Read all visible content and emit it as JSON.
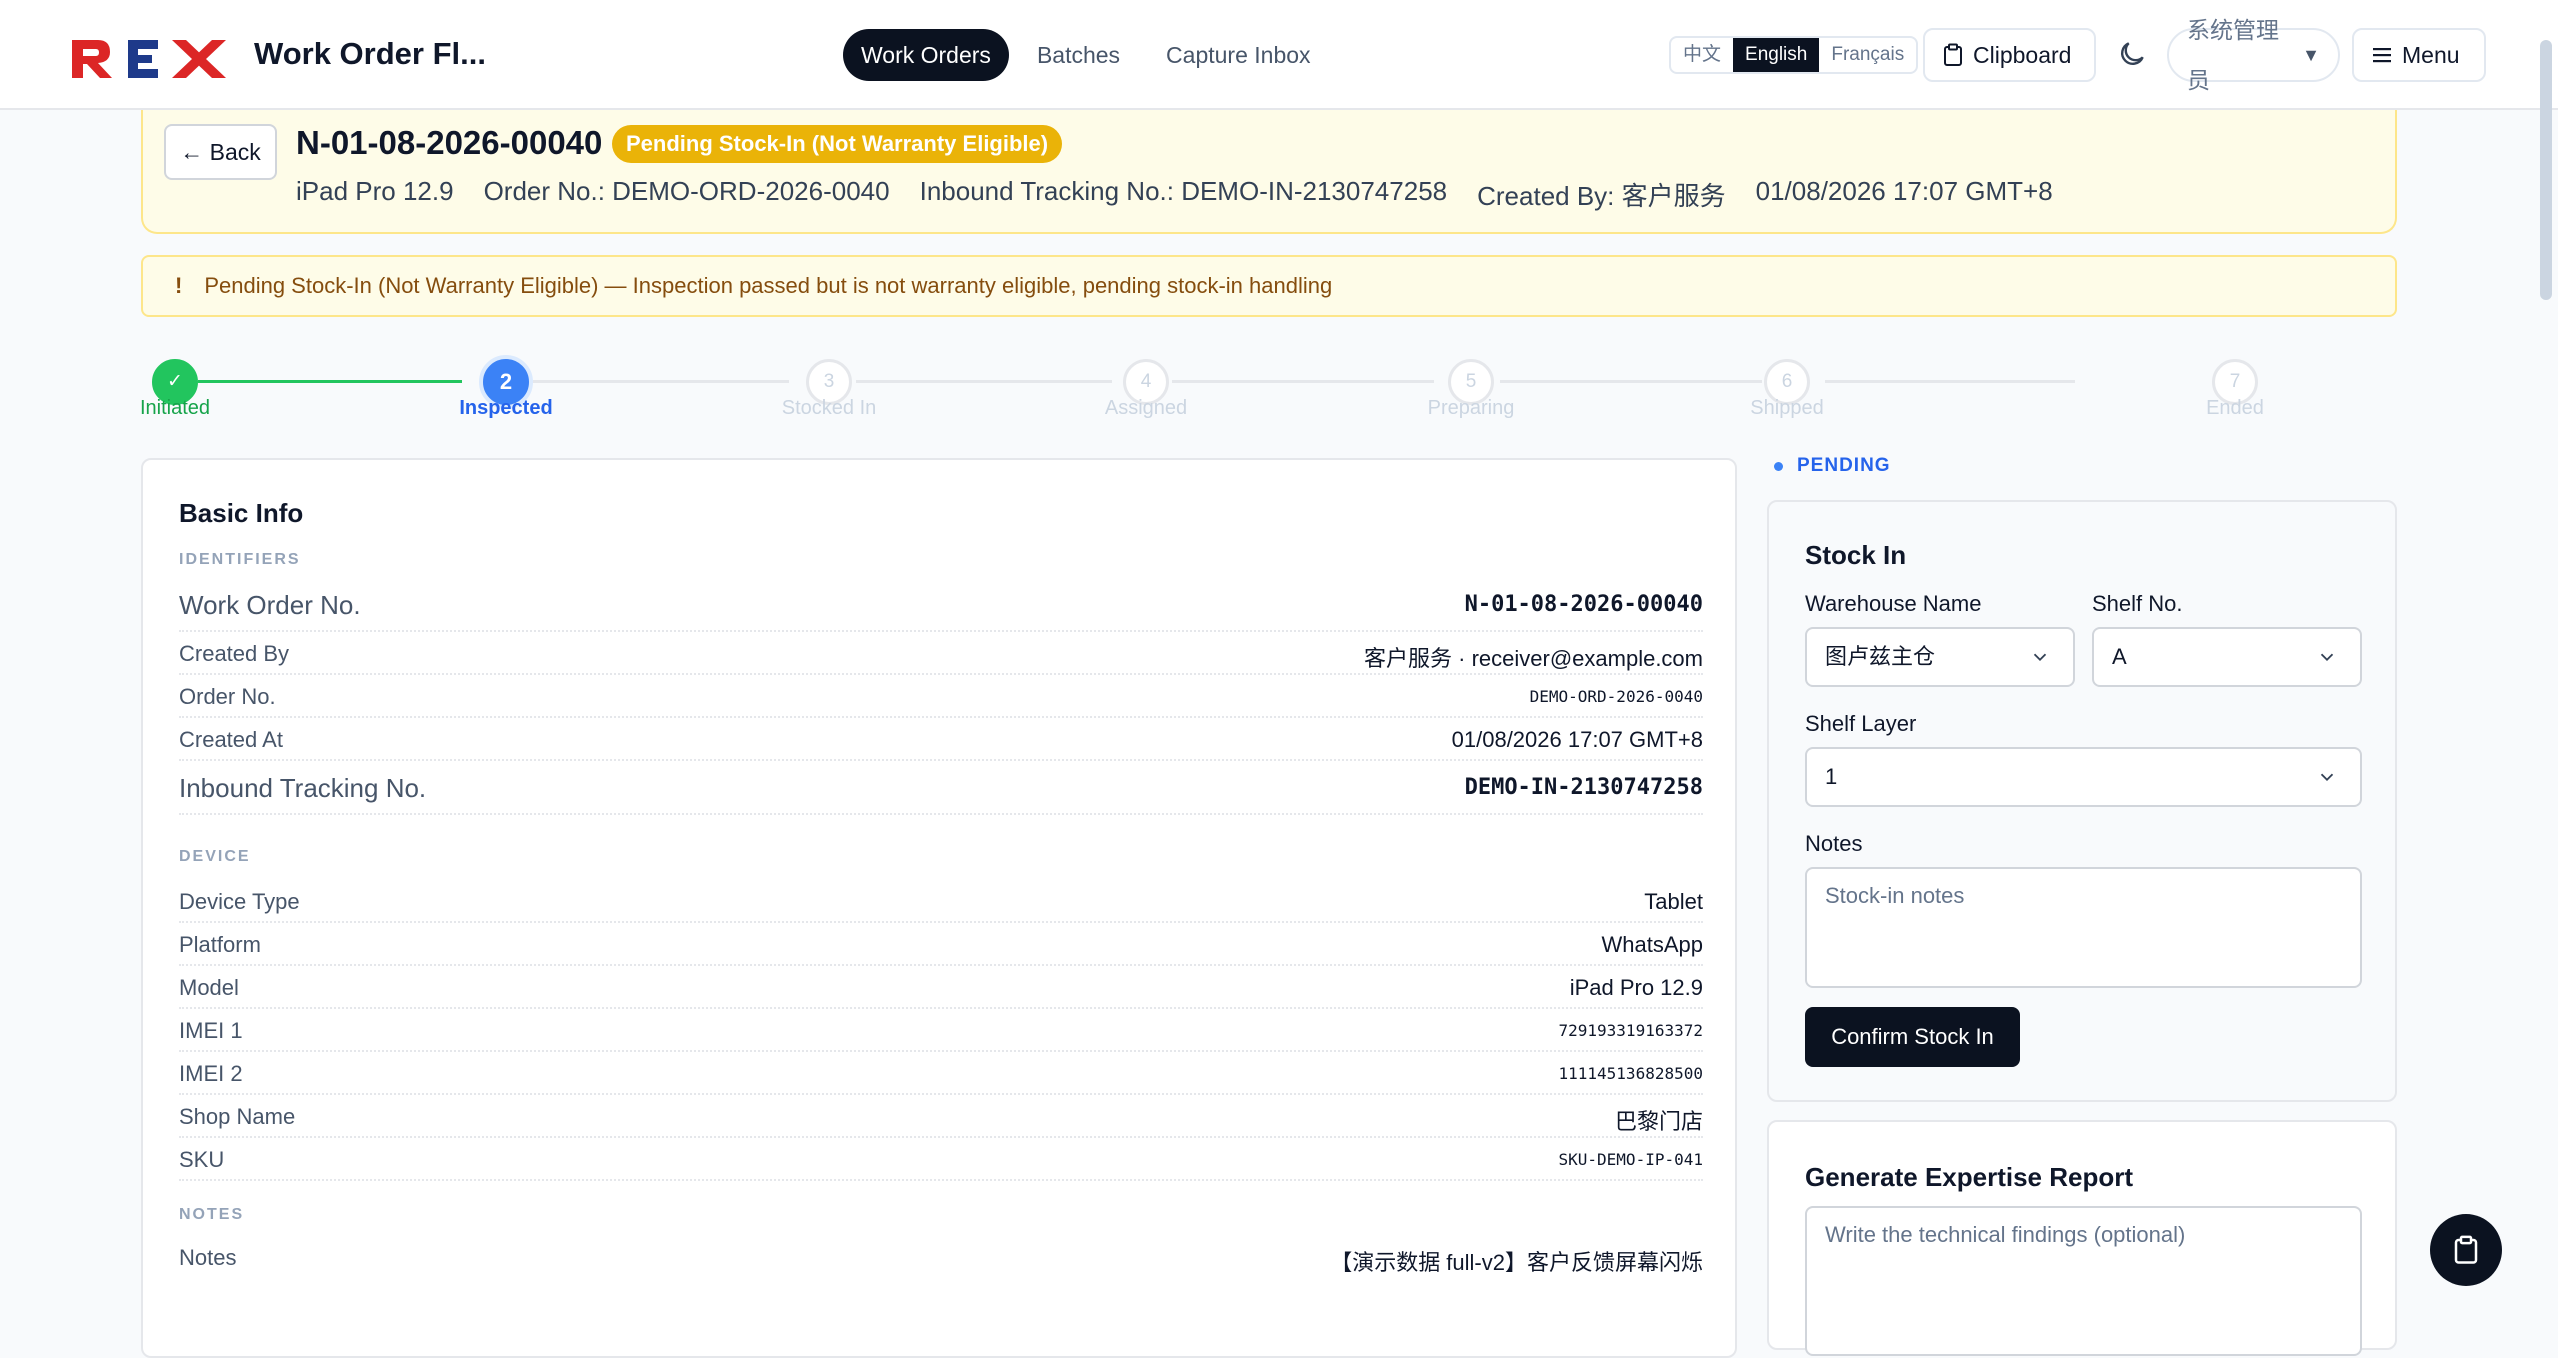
{
  "app": {
    "title": "Work Order Fl...",
    "logo_text": "REX"
  },
  "nav": {
    "items": [
      "Work Orders",
      "Batches",
      "Capture Inbox"
    ],
    "active": "Work Orders"
  },
  "languages": {
    "options": [
      "中文",
      "English",
      "Français"
    ],
    "active": "English"
  },
  "toolbar": {
    "clipboard_label": "Clipboard",
    "user_label": "系统管理员",
    "user_caret": "▼",
    "menu_label": "Menu"
  },
  "header": {
    "back_label": "← Back",
    "work_order_id": "N-01-08-2026-00040",
    "status_badge": "Pending Stock-In (Not Warranty Eligible)",
    "model": "iPad Pro 12.9",
    "order_no": "Order No.: DEMO-ORD-2026-0040",
    "inbound_tracking": "Inbound Tracking No.: DEMO-IN-2130747258",
    "created_by": "Created By: 客户服务",
    "created_at": "01/08/2026 17:07 GMT+8"
  },
  "alert": {
    "icon": "!",
    "message": "Pending Stock-In (Not Warranty Eligible)  —  Inspection passed but is not warranty eligible, pending stock-in handling"
  },
  "stepper": {
    "steps": [
      {
        "label": "Initiated",
        "number": "✓",
        "state": "done"
      },
      {
        "label": "Inspected",
        "number": "2",
        "state": "current"
      },
      {
        "label": "Stocked In",
        "number": "3",
        "state": "todo"
      },
      {
        "label": "Assigned",
        "number": "4",
        "state": "todo"
      },
      {
        "label": "Preparing",
        "number": "5",
        "state": "todo"
      },
      {
        "label": "Shipped",
        "number": "6",
        "state": "todo"
      },
      {
        "label": "Ended",
        "number": "7",
        "state": "todo"
      }
    ]
  },
  "basic_info": {
    "title": "Basic Info",
    "identifiers_heading": "IDENTIFIERS",
    "identifiers": [
      {
        "key": "Work Order No.",
        "value": "N-01-08-2026-00040"
      },
      {
        "key": "Created By",
        "value": "客户服务 · receiver@example.com"
      },
      {
        "key": "Order No.",
        "value": "DEMO-ORD-2026-0040"
      },
      {
        "key": "Created At",
        "value": "01/08/2026 17:07 GMT+8"
      },
      {
        "key": "Inbound Tracking No.",
        "value": "DEMO-IN-2130747258"
      }
    ],
    "device_heading": "DEVICE",
    "device": [
      {
        "key": "Device Type",
        "value": "Tablet"
      },
      {
        "key": "Platform",
        "value": "WhatsApp"
      },
      {
        "key": "Model",
        "value": "iPad Pro 12.9"
      },
      {
        "key": "IMEI 1",
        "value": "729193319163372"
      },
      {
        "key": "IMEI 2",
        "value": "111145136828500"
      },
      {
        "key": "Shop Name",
        "value": "巴黎门店"
      },
      {
        "key": "SKU",
        "value": "SKU-DEMO-IP-041"
      }
    ],
    "notes_heading": "NOTES",
    "notes": [
      {
        "key": "Notes",
        "value": "【演示数据 full-v2】客户反馈屏幕闪烁"
      }
    ]
  },
  "side": {
    "pending_label": "PENDING",
    "stock_in": {
      "title": "Stock In",
      "warehouse_label": "Warehouse Name",
      "warehouse_value": "图卢兹主仓",
      "shelf_label": "Shelf No.",
      "shelf_value": "A",
      "layer_label": "Shelf Layer",
      "layer_value": "1",
      "notes_label": "Notes",
      "notes_placeholder": "Stock-in notes",
      "confirm_label": "Confirm Stock In"
    },
    "report": {
      "title": "Generate Expertise Report",
      "placeholder": "Write the technical findings (optional)"
    }
  },
  "colors": {
    "accent_dark": "#0b1220",
    "status_yellow": "#eab308",
    "done_green": "#22c55e",
    "current_blue": "#3b82f6",
    "logo_red": "#dc2626",
    "logo_blue": "#1e3a8a"
  }
}
